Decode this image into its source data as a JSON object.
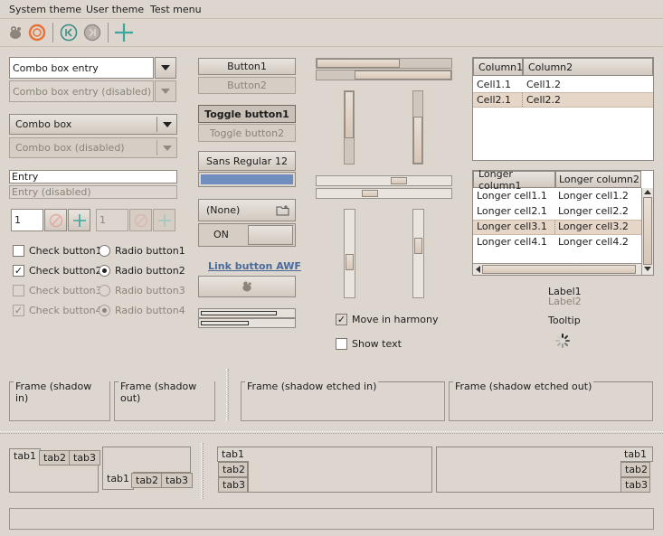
{
  "menu": [
    "System theme",
    "User theme",
    "Test menu"
  ],
  "toolbar": {
    "icons": [
      "gimp-icon",
      "record-icon",
      "skip-back-icon",
      "skip-forward-icon",
      "plus-icon"
    ]
  },
  "col1": {
    "combo_entry": "Combo box entry",
    "combo_entry_dis": "Combo box entry (disabled)",
    "combo": "Combo box",
    "combo_dis": "Combo box (disabled)",
    "entry": "Entry",
    "entry_dis": "Entry (disabled)",
    "spin1": "1",
    "spin2": "1",
    "checks": [
      "Check button1",
      "Check button2",
      "Check button3",
      "Check button4"
    ],
    "radios": [
      "Radio button1",
      "Radio button2",
      "Radio button3",
      "Radio button4"
    ]
  },
  "col2": {
    "button1": "Button1",
    "button2": "Button2",
    "toggle1": "Toggle button1",
    "toggle2": "Toggle button2",
    "font_name": "Sans Regular",
    "font_size": "12",
    "file_none": "(None)",
    "switch_on": "ON",
    "link": "Link button AWF",
    "progress": [
      0.82,
      0.52
    ]
  },
  "col3": {
    "hscale": [
      0.62,
      0.28
    ],
    "vscale": [
      0.08,
      0.0
    ],
    "scale_h2": [
      0.64,
      0.42
    ],
    "move_harmony": "Move in harmony",
    "show_text": "Show text"
  },
  "col4": {
    "tree1": {
      "headers": [
        "Column1",
        "Column2"
      ],
      "rows": [
        [
          "Cell1.1",
          "Cell1.2"
        ],
        [
          "Cell2.1",
          "Cell2.2"
        ]
      ]
    },
    "tree2": {
      "headers": [
        "Longer column1",
        "Longer column2"
      ],
      "rows": [
        [
          "Longer cell1.1",
          "Longer cell1.2"
        ],
        [
          "Longer cell2.1",
          "Longer cell2.2"
        ],
        [
          "Longer cell3.1",
          "Longer cell3.2"
        ],
        [
          "Longer cell4.1",
          "Longer cell4.2"
        ]
      ]
    },
    "label1": "Label1",
    "label2": "Label2",
    "tooltip": "Tooltip"
  },
  "frames": [
    "Frame (shadow in)",
    "Frame (shadow out)",
    "Frame (shadow etched in)",
    "Frame (shadow etched out)"
  ],
  "tabs": [
    "tab1",
    "tab2",
    "tab3"
  ],
  "colors": {
    "accent": "#6f8dbd",
    "selection": "#e5d6c8",
    "bg": "#ddd6ce"
  }
}
